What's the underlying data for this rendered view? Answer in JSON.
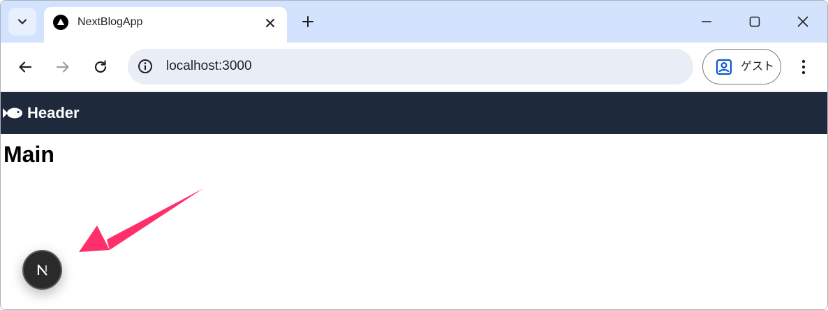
{
  "browser": {
    "tab_title": "NextBlogApp",
    "url": "localhost:3000",
    "profile_label": "ゲスト"
  },
  "page": {
    "header_title": "Header",
    "main_title": "Main",
    "header_bg_color": "#1e293b"
  },
  "icons": {
    "tab_search": "chevron-down-icon",
    "favicon": "nextjs-triangle-icon",
    "tab_close": "close-icon",
    "new_tab": "plus-icon",
    "minimize": "minimize-icon",
    "maximize": "maximize-icon",
    "window_close": "close-icon",
    "back": "arrow-left-icon",
    "forward": "arrow-right-icon",
    "reload": "reload-icon",
    "site_info": "info-icon",
    "profile": "person-icon",
    "menu": "more-vertical-icon",
    "header_logo": "fish-icon",
    "dev_indicator": "nextjs-n-icon"
  },
  "annotation": {
    "arrow_color": "#ff2f6b"
  }
}
